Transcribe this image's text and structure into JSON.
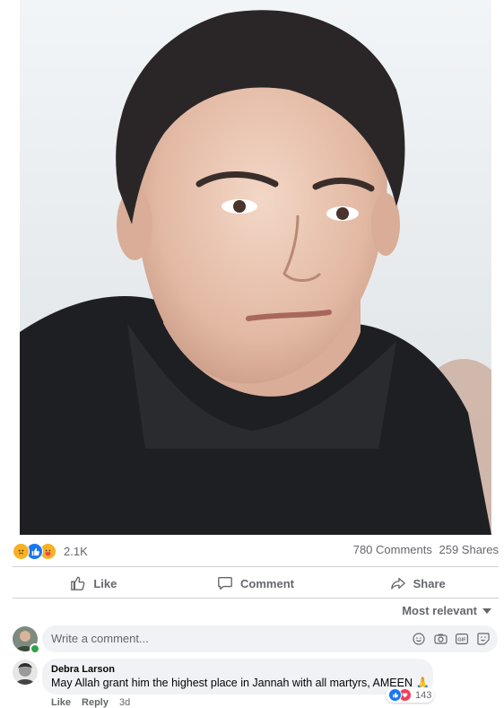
{
  "post": {
    "reactions": {
      "icons": [
        "sad-emoji-icon",
        "like-icon",
        "care-emoji-icon"
      ],
      "count": "2.1K"
    },
    "comments_count": "780 Comments",
    "shares_count": "259 Shares"
  },
  "actions": {
    "like": "Like",
    "comment": "Comment",
    "share": "Share"
  },
  "sort": {
    "label": "Most relevant"
  },
  "composer": {
    "placeholder": "Write a comment..."
  },
  "comment": {
    "author": "Debra Larson",
    "text": "May Allah grant him the highest place in Jannah with all martyrs, AMEEN 🙏",
    "reaction_count": "143",
    "like_label": "Like",
    "reply_label": "Reply",
    "time": "3d"
  },
  "colors": {
    "brand": "#1877f2",
    "muted": "#65676b",
    "surface": "#f0f2f5",
    "divider": "#ced0d4"
  }
}
